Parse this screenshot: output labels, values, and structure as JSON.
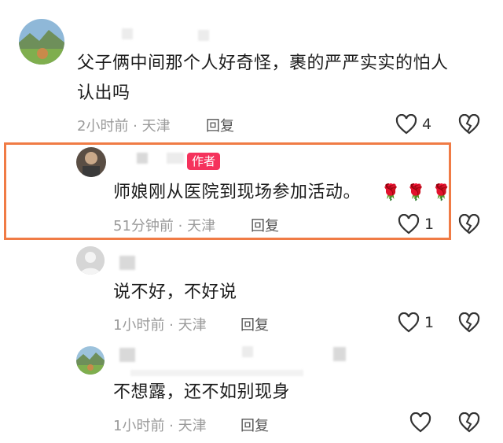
{
  "comments": [
    {
      "text": "父子俩中间那个人好奇怪，裹的严严实实的怕人认出吗",
      "line1": "父子俩中间那个人好奇怪，裹的严严实实的怕人",
      "line2": "认出吗",
      "meta": "2小时前 · 天津",
      "reply": "回复",
      "likes": "4"
    },
    {
      "badge": "作者",
      "text": "师娘刚从医院到现场参加活动。",
      "emoji": "🌹 🌹 🌹",
      "meta": "51分钟前 · 天津",
      "reply": "回复",
      "likes": "1"
    },
    {
      "text": "说不好，不好说",
      "meta": "1小时前 · 天津",
      "reply": "回复",
      "likes": "1"
    },
    {
      "text": "不想露，还不如别现身",
      "meta": "1小时前 · 天津",
      "reply": "回复",
      "likes": ""
    }
  ],
  "icons": {
    "like": "heart-outline-icon",
    "dislike": "broken-heart-icon"
  },
  "colors": {
    "highlight_border": "#f07b45",
    "author_badge": "#f5325c"
  }
}
